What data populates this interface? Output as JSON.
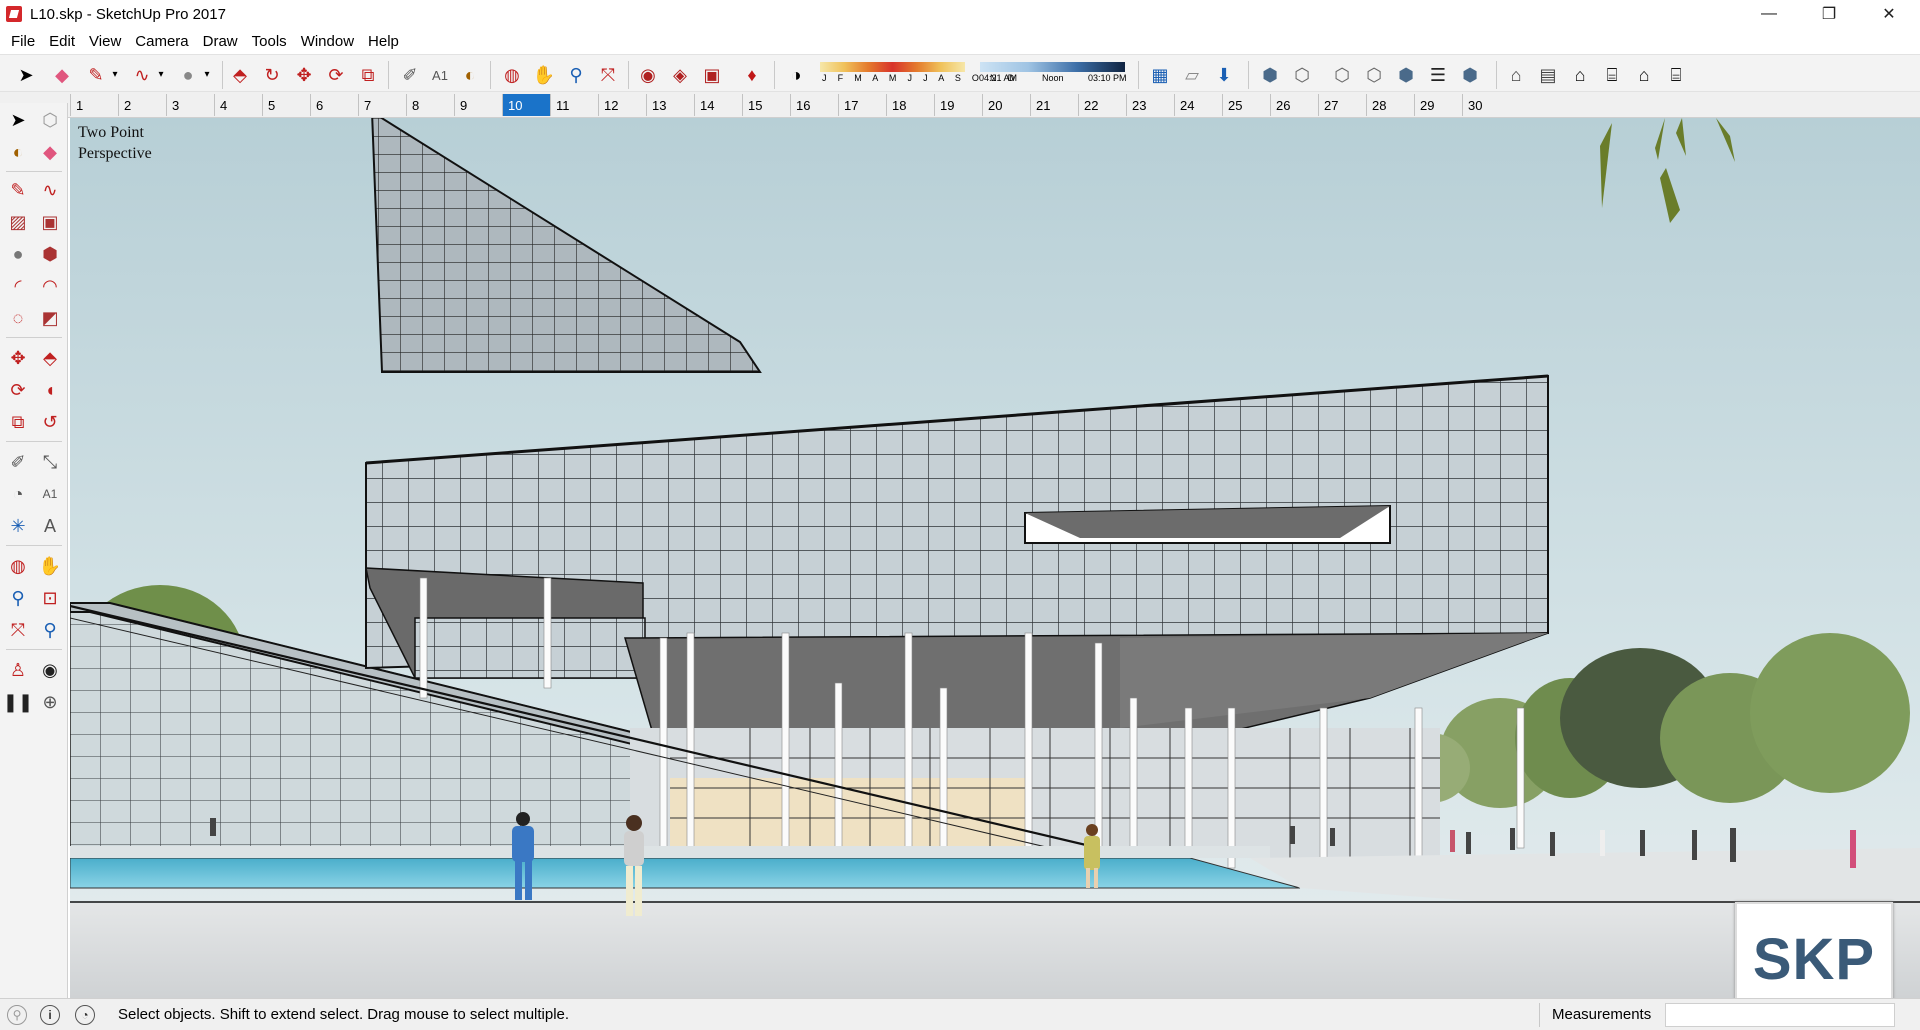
{
  "window": {
    "title": "L10.skp - SketchUp Pro 2017",
    "controls": {
      "minimize": "—",
      "maximize": "❐",
      "close": "✕"
    }
  },
  "menu": [
    "File",
    "Edit",
    "View",
    "Camera",
    "Draw",
    "Tools",
    "Window",
    "Help"
  ],
  "toolbar": {
    "icons": [
      "select-arrow",
      "eraser",
      "pencil-line",
      "freehand-dropdown",
      "rectangle-dropdown",
      "circle-dropdown",
      "push-pull",
      "follow-me",
      "move",
      "rotate",
      "scale",
      "tape-measure",
      "text",
      "paint-bucket",
      "orbit",
      "pan",
      "zoom",
      "zoom-extents",
      "warehouse-get",
      "warehouse-share",
      "extension-warehouse",
      "ruby-gem",
      "shadows-toggle",
      "style-xray",
      "style-back-edges",
      "style-wireframe",
      "style-hidden-line",
      "style-shaded",
      "style-shaded-textures",
      "style-monochrome",
      "view-iso",
      "view-top",
      "view-front",
      "view-right",
      "view-back",
      "view-left"
    ],
    "shadow_months": "J F M A M J J A S O N D",
    "shadow_times": [
      "04:21 AM",
      "Noon",
      "03:10 PM"
    ]
  },
  "scene_tabs": [
    "1",
    "2",
    "3",
    "4",
    "5",
    "6",
    "7",
    "8",
    "9",
    "10",
    "11",
    "12",
    "13",
    "14",
    "15",
    "16",
    "17",
    "18",
    "19",
    "20",
    "21",
    "22",
    "23",
    "24",
    "25",
    "26",
    "27",
    "28",
    "29",
    "30"
  ],
  "active_scene": "10",
  "palette_icons": [
    "select",
    "component",
    "paint-bucket",
    "eraser",
    "line",
    "freehand",
    "rectangle",
    "rotated-rectangle",
    "circle",
    "polygon",
    "arc",
    "2-point-arc",
    "3-point-arc",
    "pie",
    "move",
    "push-pull",
    "rotate",
    "follow-me",
    "scale",
    "offset",
    "tape-measure",
    "dimension",
    "protractor",
    "text",
    "axes",
    "3d-text",
    "orbit",
    "pan",
    "zoom",
    "zoom-window",
    "zoom-extents",
    "previous-view",
    "position-camera",
    "look-around",
    "walk",
    "section-plane"
  ],
  "viewport": {
    "view_label": [
      "Two Point",
      "Perspective"
    ],
    "logo_text": "SKP"
  },
  "statusbar": {
    "message": "Select objects. Shift to extend select. Drag mouse to select multiple.",
    "measurements_label": "Measurements",
    "measurements_value": ""
  },
  "colors": {
    "accent": "#1a73c9",
    "sky": "#c6dadf",
    "pool": "#6fc3da",
    "glass": "#c3cdd2",
    "underside": "#6f6f6f"
  }
}
